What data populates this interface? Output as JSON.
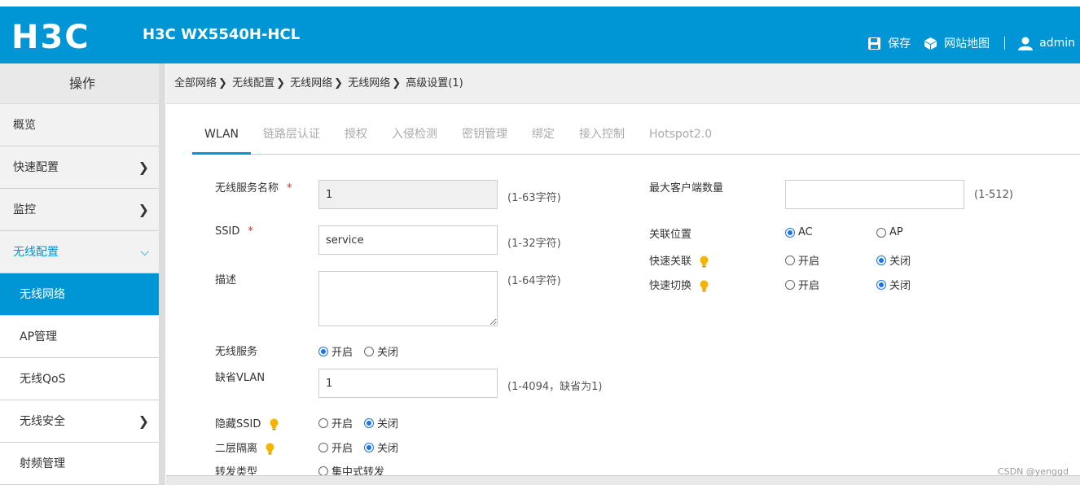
{
  "header": {
    "logo": "H3C",
    "device": "H3C WX5540H-HCL",
    "save": "保存",
    "sitemap": "网站地图",
    "user": "admin"
  },
  "sidebar": {
    "title": "操作",
    "items": [
      {
        "label": "概览"
      },
      {
        "label": "快速配置"
      },
      {
        "label": "监控"
      },
      {
        "label": "无线配置"
      },
      {
        "label": "无线网络"
      },
      {
        "label": "AP管理"
      },
      {
        "label": "无线QoS"
      },
      {
        "label": "无线安全"
      },
      {
        "label": "射频管理"
      }
    ]
  },
  "breadcrumb": [
    "全部网络",
    "无线配置",
    "无线网络",
    "无线网络",
    "高级设置(1)"
  ],
  "tabs": [
    "WLAN",
    "链路层认证",
    "授权",
    "入侵检测",
    "密钥管理",
    "绑定",
    "接入控制",
    "Hotspot2.0"
  ],
  "form": {
    "service_name_label": "无线服务名称",
    "service_name_value": "1",
    "service_name_hint": "(1-63字符)",
    "ssid_label": "SSID",
    "ssid_value": "service",
    "ssid_hint": "(1-32字符)",
    "desc_label": "描述",
    "desc_hint": "(1-64字符)",
    "wireless_service_label": "无线服务",
    "default_vlan_label": "缺省VLAN",
    "default_vlan_value": "1",
    "default_vlan_hint": "(1-4094，缺省为1)",
    "hide_ssid_label": "隐藏SSID",
    "l2_isolation_label": "二层隔离",
    "forward_type_label": "转发类型",
    "forward_central": "集中式转发",
    "max_clients_label": "最大客户端数量",
    "max_clients_hint": "(1-512)",
    "assoc_location_label": "关联位置",
    "assoc_ac": "AC",
    "assoc_ap": "AP",
    "fast_assoc_label": "快速关联",
    "fast_switch_label": "快速切换",
    "on": "开启",
    "off": "关闭"
  },
  "watermark": "CSDN @yenggd",
  "colors": {
    "accent": "#0096d6",
    "required": "#d32f2f",
    "radio": "#1a73e8",
    "bulb": "#f5b400"
  }
}
